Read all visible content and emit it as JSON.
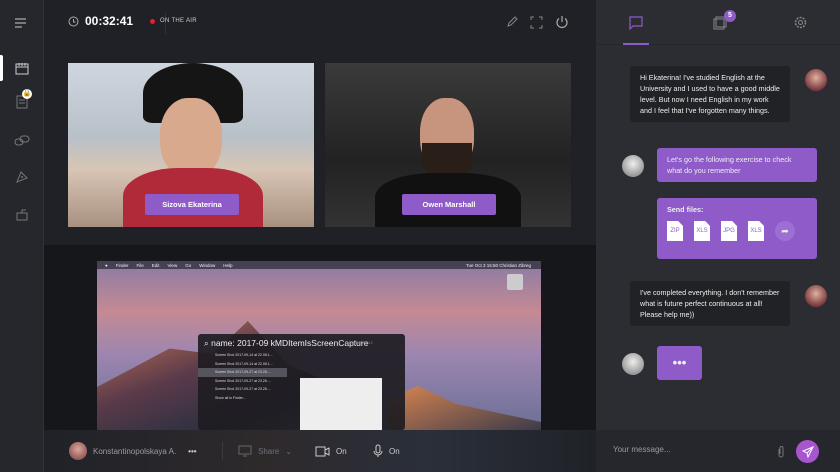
{
  "topbar": {
    "timer": "00:32:41",
    "status": "ON THE AIR"
  },
  "videos": [
    {
      "name": "Sizova Ekaterina"
    },
    {
      "name": "Owen Marshall"
    }
  ],
  "screen_share": {
    "menubar": [
      "Finder",
      "File",
      "Edit",
      "View",
      "Go",
      "Window",
      "Help"
    ],
    "menubar_right": "Tue Oct 3  15:50   Christian Zibreg",
    "search_query": "name: 2017-09 kMDItemIsScreenCapture",
    "search_hint": "— Screen Shot 2",
    "results": [
      "Screen Shot 2017-09-14 at 22.08.1...",
      "Screen Shot 2017-09-14 at 22.08.1...",
      "Screen Shot 2017-09-27 at 23.26....",
      "Screen Shot 2017-09-27 at 23.26....",
      "Screen Shot 2017-09-27 at 23.26....",
      "Show all in Finder..."
    ]
  },
  "bottombar": {
    "user": "Konstantinopolskaya A.",
    "more": "•••",
    "share": "Share",
    "camera": "On",
    "mic": "On"
  },
  "right": {
    "badge_count": "5",
    "messages": [
      {
        "text": "Hi Ekaterina! I've studied English at the University and I used to have a good middle level. But now I need English in my work and I feel that I've forgotten many things."
      },
      {
        "text": "Let's go the following exercise to check what do you remember"
      },
      {
        "title": "Send files:",
        "files": [
          "ZIP",
          "XLS",
          "JPG",
          "XLS"
        ]
      },
      {
        "text": "I've completed everything. I don't remember what is future perfect continuous at all! Please help me))"
      },
      {
        "text": "•••"
      }
    ],
    "input_placeholder": "Your message..."
  }
}
